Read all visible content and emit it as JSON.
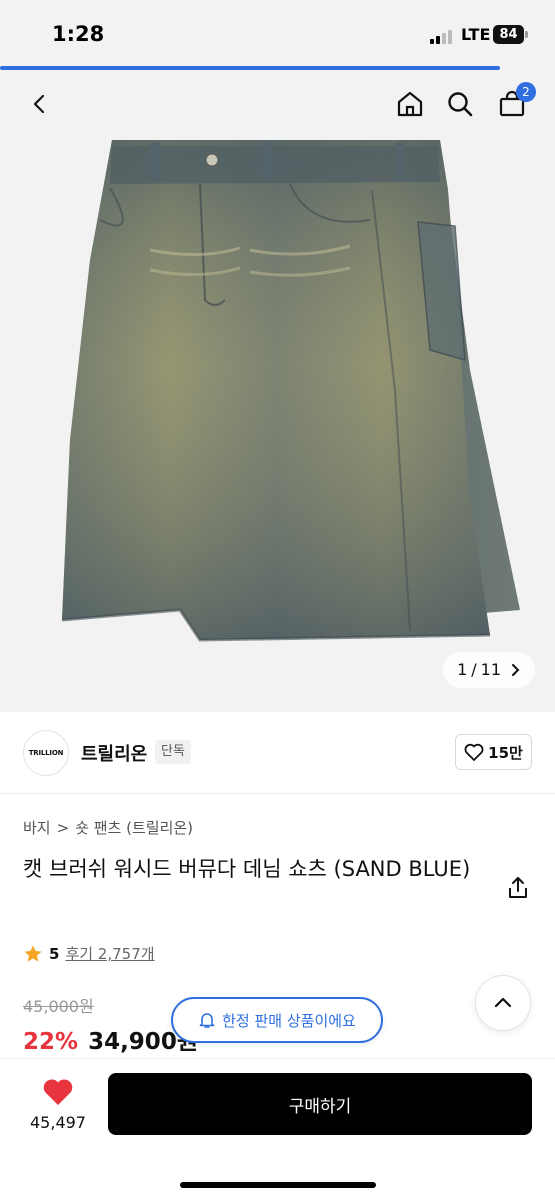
{
  "status_bar": {
    "time": "1:28",
    "network": "LTE",
    "battery": "84"
  },
  "page_progress": 0.9,
  "nav": {
    "cart_count": "2"
  },
  "gallery": {
    "current": "1",
    "separator": "/",
    "total": "11"
  },
  "brand": {
    "logo_text": "TRILLION",
    "name": "트릴리온",
    "tag": "단독",
    "likes": "15만"
  },
  "breadcrumb": {
    "category": "바지",
    "separator": ">",
    "subcategory": "숏 팬츠 (트릴리온)"
  },
  "product": {
    "title": "캣 브러쉬 워시드 버뮤다 데님 쇼츠 (SAND BLUE)",
    "rating": "5",
    "reviews": "후기 2,757개",
    "original_price": "45,000원",
    "discount": "22%",
    "price": "34,900원"
  },
  "toast": {
    "text": "한정 판매 상품이에요"
  },
  "bottom_bar": {
    "wish_count": "45,497",
    "buy_label": "구매하기"
  },
  "colors": {
    "accent": "#2f6fe0",
    "discount": "#e8343f",
    "heart": "#e8343f",
    "star": "#f5a623"
  }
}
